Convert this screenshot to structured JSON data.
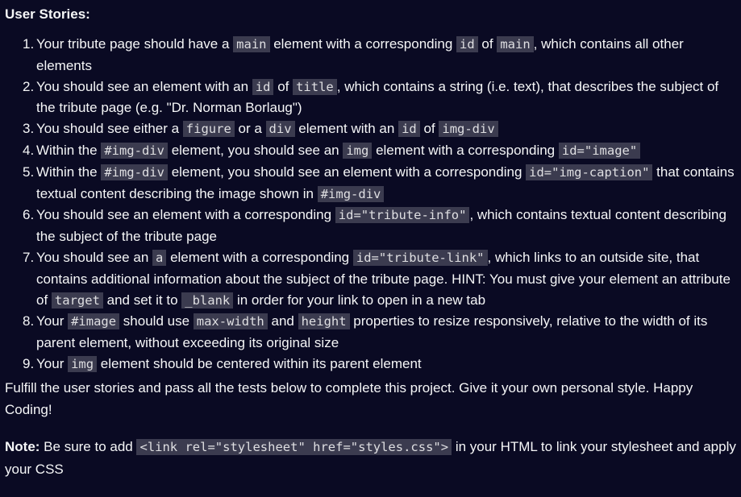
{
  "heading": "User Stories:",
  "stories": [
    {
      "num": "1.",
      "parts": [
        {
          "t": "Your tribute page should have a "
        },
        {
          "c": "main"
        },
        {
          "t": " element with a corresponding "
        },
        {
          "c": "id"
        },
        {
          "t": " of "
        },
        {
          "c": "main"
        },
        {
          "t": ", which contains all other elements"
        }
      ]
    },
    {
      "num": "2.",
      "parts": [
        {
          "t": "You should see an element with an "
        },
        {
          "c": "id"
        },
        {
          "t": " of "
        },
        {
          "c": "title"
        },
        {
          "t": ", which contains a string (i.e. text), that describes the subject of the tribute page (e.g. \"Dr. Norman Borlaug\")"
        }
      ]
    },
    {
      "num": "3.",
      "parts": [
        {
          "t": "You should see either a "
        },
        {
          "c": "figure"
        },
        {
          "t": " or a "
        },
        {
          "c": "div"
        },
        {
          "t": " element with an "
        },
        {
          "c": "id"
        },
        {
          "t": " of "
        },
        {
          "c": "img-div"
        }
      ]
    },
    {
      "num": "4.",
      "parts": [
        {
          "t": "Within the "
        },
        {
          "c": "#img-div"
        },
        {
          "t": " element, you should see an "
        },
        {
          "c": "img"
        },
        {
          "t": " element with a corresponding "
        },
        {
          "c": "id=\"image\""
        }
      ]
    },
    {
      "num": "5.",
      "parts": [
        {
          "t": "Within the "
        },
        {
          "c": "#img-div"
        },
        {
          "t": " element, you should see an element with a corresponding "
        },
        {
          "c": "id=\"img-caption\""
        },
        {
          "t": " that contains textual content describing the image shown in "
        },
        {
          "c": "#img-div"
        }
      ]
    },
    {
      "num": "6.",
      "parts": [
        {
          "t": "You should see an element with a corresponding "
        },
        {
          "c": "id=\"tribute-info\""
        },
        {
          "t": ", which contains textual content describing the subject of the tribute page"
        }
      ]
    },
    {
      "num": "7.",
      "parts": [
        {
          "t": "You should see an "
        },
        {
          "c": "a"
        },
        {
          "t": " element with a corresponding "
        },
        {
          "c": "id=\"tribute-link\""
        },
        {
          "t": ", which links to an outside site, that contains additional information about the subject of the tribute page. HINT: You must give your element an attribute of "
        },
        {
          "c": "target"
        },
        {
          "t": " and set it to "
        },
        {
          "c": "_blank"
        },
        {
          "t": " in order for your link to open in a new tab"
        }
      ]
    },
    {
      "num": "8.",
      "parts": [
        {
          "t": "Your "
        },
        {
          "c": "#image"
        },
        {
          "t": " should use "
        },
        {
          "c": "max-width"
        },
        {
          "t": " and "
        },
        {
          "c": "height"
        },
        {
          "t": " properties to resize responsively, relative to the width of its parent element, without exceeding its original size"
        }
      ]
    },
    {
      "num": "9.",
      "parts": [
        {
          "t": "Your "
        },
        {
          "c": "img"
        },
        {
          "t": " element should be centered within its parent element"
        }
      ]
    }
  ],
  "intro": "Fulfill the user stories and pass all the tests below to complete this project. Give it your own personal style. Happy Coding!",
  "note": {
    "label": "Note:",
    "before": " Be sure to add ",
    "code": "<link rel=\"stylesheet\" href=\"styles.css\">",
    "after": " in your HTML to link your stylesheet and apply your CSS"
  }
}
